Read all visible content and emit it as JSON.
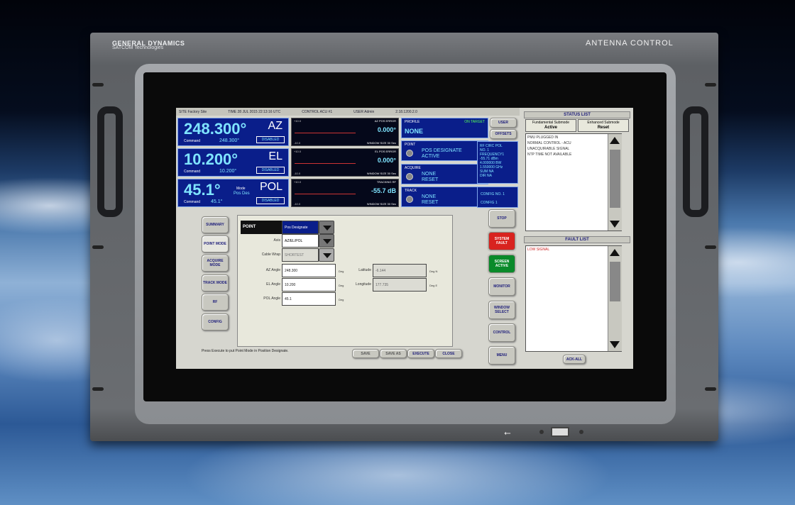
{
  "device": {
    "brand": "GENERAL DYNAMICS",
    "brand_sub": "SATCOM Technologies",
    "title": "ANTENNA CONTROL",
    "usb_symbol": "⭠"
  },
  "topbar": {
    "site": "SITE Factory Site",
    "time": "TIME 28 JUL 2015 22:13:16 UTC",
    "control": "CONTROL ACU #1",
    "user": "USER Admin",
    "version": "2.18.1200.2.0"
  },
  "axes": [
    {
      "value": "248.300°",
      "name": "AZ",
      "cmd_label": "Command",
      "cmd_value": "248.300°",
      "status": "DISABLED"
    },
    {
      "value": "10.200°",
      "name": "EL",
      "cmd_label": "Command",
      "cmd_value": "10.200°",
      "status": "DISABLED"
    },
    {
      "value": "45.1°",
      "name": "POL",
      "mode_label": "Mode",
      "mode_value": "Pos Des",
      "cmd_label": "Command",
      "cmd_value": "45.1°",
      "status": "DISABLED"
    }
  ],
  "plots": [
    {
      "top": "+10.0",
      "bottom": "-10.0",
      "head": "AZ POS ERROR",
      "value": "0.000°",
      "window": "WINDOW SIZE 30 Sec"
    },
    {
      "top": "+10.0",
      "bottom": "-10.0",
      "head": "EL POS ERROR",
      "value": "0.000°",
      "window": "WINDOW SIZE 30 Sec"
    },
    {
      "top": "+10.0",
      "bottom": "-10.0",
      "head": "TRACKING RF",
      "value": "-55.7 dB",
      "window": "WINDOW SIZE 30 Sec"
    }
  ],
  "profile": {
    "label": "PROFILE",
    "status": "ON TARGET",
    "value": "NONE"
  },
  "status_boxes": [
    {
      "label": "POINT",
      "line1": "POS DESIGNATE",
      "line2": "ACTIVE"
    },
    {
      "label": "ACQUIRE",
      "line1": "NONE",
      "line2": "RESET"
    },
    {
      "label": "TRACK",
      "line1": "NONE",
      "line2": "RESET"
    }
  ],
  "top_buttons": {
    "user": "USER",
    "offsets": "OFFSETS"
  },
  "rf": {
    "line1": "RF  CIRC  POL",
    "line2": "NO. 1",
    "line3": "FREQUENCY1",
    "line4": "-55.71  dBm",
    "line5": "4.000000  BW",
    "line6": "1.550000  GHz",
    "line7": "SUM  NA",
    "line8": "DIR  NA"
  },
  "config": {
    "line1": "CONFIG  NO. 1",
    "line2": "CONFIG 1"
  },
  "nav": [
    "SUMMARY",
    "POINT MODE",
    "ACQUIRE MODE",
    "TRACK MODE",
    "RF",
    "CONFIG"
  ],
  "form": {
    "header": "POINT",
    "mode_value": "Pos Designate",
    "axis_label": "Axis",
    "axis_value": "AZ/EL/POL",
    "cable_label": "Cable Wrap",
    "cable_value": "SHORTEST",
    "az_label": "AZ Angle",
    "az_value": "248.300",
    "el_label": "EL Angle",
    "el_value": "10.200",
    "pol_label": "POL Angle",
    "pol_value": "45.1",
    "deg": "Deg",
    "lat_label": "Latitude",
    "lat_value": "-6.144",
    "lat_unit": "Deg N",
    "lon_label": "Longitude",
    "lon_value": "177.735",
    "lon_unit": "Deg E"
  },
  "status_text": "Press Execute to put Point Mode in Position Designate.",
  "bottom_buttons": [
    "SAVE",
    "SAVE AS",
    "EXECUTE",
    "CLOSE"
  ],
  "right_buttons": [
    "STOP",
    "SYSTEM FAULT",
    "SCREEN ACTIVE",
    "MONITOR",
    "WINDOW SELECT",
    "CONTROL",
    "MENU"
  ],
  "status_list": {
    "title": "STATUS LIST",
    "sub1_label": "Fundamental Submode",
    "sub1_value": "Active",
    "sub2_label": "Enhanced Submode",
    "sub2_value": "Reset",
    "messages": [
      "PMU PLUGGED IN",
      "NORMAL CONTROL - ACU",
      "UNACQUIRABLE SIGNAL",
      "NTP TIME NOT AVAILABLE"
    ]
  },
  "fault_list": {
    "title": "FAULT LIST",
    "messages": [
      "LOW SIGNAL"
    ],
    "ack_all": "ACK-ALL"
  },
  "colors": {
    "panel_blue": "#0a1e8a",
    "value_cyan": "#7fe4ff",
    "fault_red": "#d8231f",
    "active_green": "#0a8a2a"
  }
}
